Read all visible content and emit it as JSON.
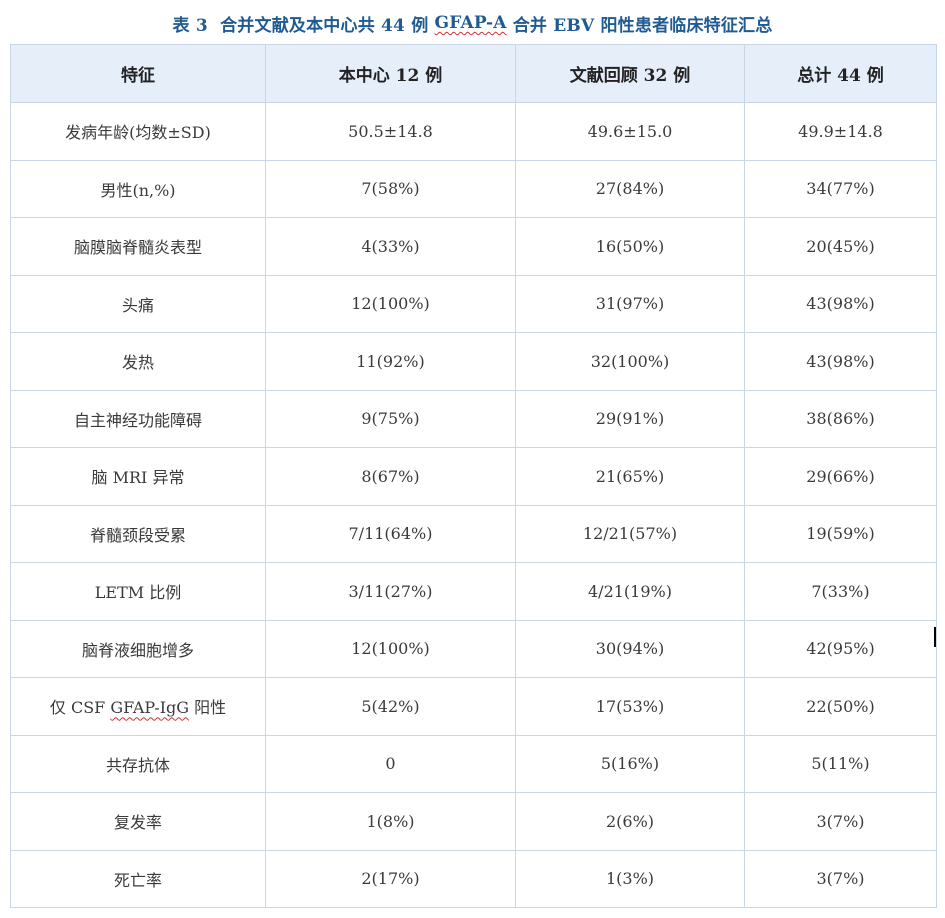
{
  "caption": {
    "before": "表 3  合并文献及本中心共 44 例 ",
    "underlined": "GFAP-A",
    "after": " 合并 EBV 阳性患者临床特征汇总"
  },
  "table": {
    "headers": [
      "特征",
      "本中心 12 例",
      "文献回顾 32 例",
      "总计 44 例"
    ],
    "rows": [
      {
        "feature": "发病年龄(均数±SD)",
        "center": "50.5±14.8",
        "literature": "49.6±15.0",
        "total": "49.9±14.8"
      },
      {
        "feature": "男性(n,%)",
        "center": "7(58%)",
        "literature": "27(84%)",
        "total": "34(77%)"
      },
      {
        "feature": "脑膜脑脊髓炎表型",
        "center": "4(33%)",
        "literature": "16(50%)",
        "total": "20(45%)"
      },
      {
        "feature": "头痛",
        "center": "12(100%)",
        "literature": "31(97%)",
        "total": "43(98%)"
      },
      {
        "feature": "发热",
        "center": "11(92%)",
        "literature": "32(100%)",
        "total": "43(98%)"
      },
      {
        "feature": "自主神经功能障碍",
        "center": "9(75%)",
        "literature": "29(91%)",
        "total": "38(86%)"
      },
      {
        "feature": "脑 MRI 异常",
        "center": "8(67%)",
        "literature": "21(65%)",
        "total": "29(66%)"
      },
      {
        "feature": "脊髓颈段受累",
        "center": "7/11(64%)",
        "literature": "12/21(57%)",
        "total": "19(59%)"
      },
      {
        "feature": "LETM 比例",
        "center": "3/11(27%)",
        "literature": "4/21(19%)",
        "total": "7(33%)"
      },
      {
        "feature": "脑脊液细胞增多",
        "center": "12(100%)",
        "literature": "30(94%)",
        "total": "42(95%)"
      },
      {
        "feature_prefix": "仅 CSF ",
        "feature_underlined": "GFAP-IgG",
        "feature_suffix": " 阳性",
        "center": "5(42%)",
        "literature": "17(53%)",
        "total": "22(50%)"
      },
      {
        "feature": "共存抗体",
        "center": "0",
        "literature": "5(16%)",
        "total": "5(11%)"
      },
      {
        "feature": "复发率",
        "center": "1(8%)",
        "literature": "2(6%)",
        "total": "3(7%)"
      },
      {
        "feature": "死亡率",
        "center": "2(17%)",
        "literature": "1(3%)",
        "total": "3(7%)"
      }
    ]
  },
  "colors": {
    "caption_text": "#1f5a93",
    "header_background": "#e5eef9",
    "border": "#c9d6e6",
    "spellcheck_underline": "#d23232"
  }
}
